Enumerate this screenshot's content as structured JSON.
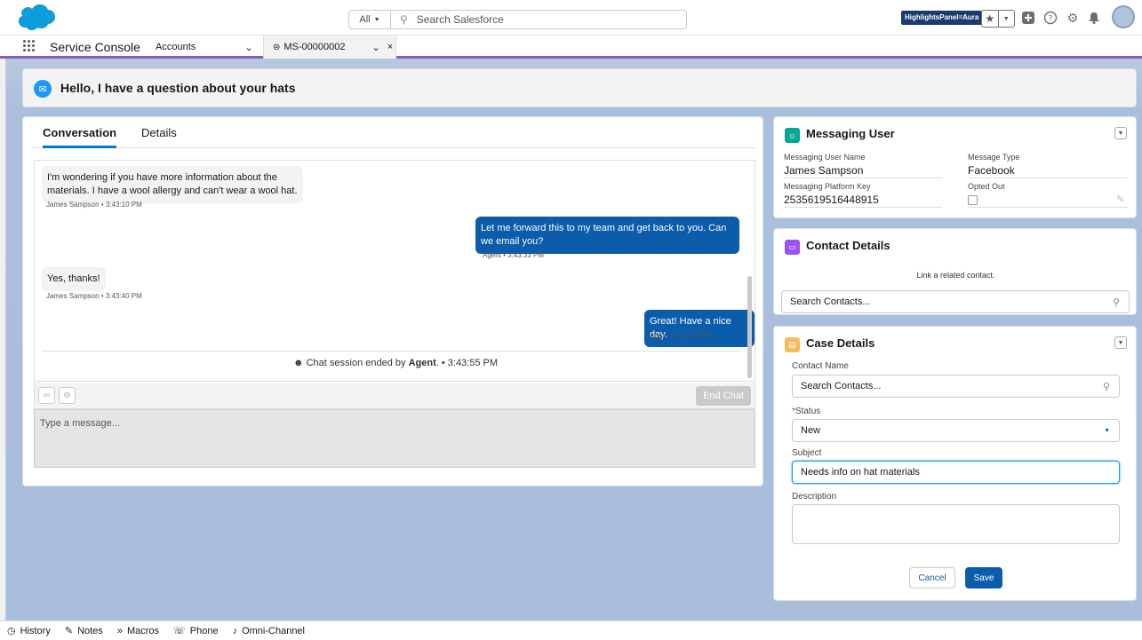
{
  "header": {
    "search_scope": "All",
    "search_placeholder": "Search Salesforce",
    "highlights_badge": "HighlightsPanel=Aura"
  },
  "nav": {
    "app_name": "Service Console",
    "tabs": [
      {
        "label": "Accounts"
      },
      {
        "label": "MS-00000002"
      }
    ]
  },
  "highlights": {
    "title": "Hello, I have a question about your hats"
  },
  "conversation": {
    "tabs": [
      "Conversation",
      "Details"
    ],
    "messages": [
      {
        "direction": "in",
        "text": "I'm wondering if you have more information about the materials. I have a wool allergy and can't wear a wool hat.",
        "meta": "James Sampson • 3:43:10 PM"
      },
      {
        "direction": "out",
        "text": "Let me forward this to my team and get back to you. Can we email you?",
        "meta": "Agent • 3:43:33 PM"
      },
      {
        "direction": "in",
        "text": "Yes, thanks!",
        "meta": "James Sampson • 3:43:40 PM"
      },
      {
        "direction": "out",
        "text": "Great! Have a nice day.",
        "meta": "Agent • 3:43:50 PM"
      }
    ],
    "ended_prefix": "Chat session ended by ",
    "ended_by": "Agent",
    "ended_suffix": ". • 3:43:55 PM",
    "end_chat_label": "End Chat",
    "compose_placeholder": "Type a message..."
  },
  "messaging_user": {
    "title": "Messaging User",
    "name_label": "Messaging User Name",
    "name_value": "James Sampson",
    "type_label": "Message Type",
    "type_value": "Facebook",
    "key_label": "Messaging Platform Key",
    "key_value": "2535619516448915",
    "opted_label": "Opted Out"
  },
  "contact_details": {
    "title": "Contact Details",
    "link_text": "Link a related contact.",
    "search_placeholder": "Search Contacts..."
  },
  "case_details": {
    "title": "Case Details",
    "contact_label": "Contact Name",
    "contact_placeholder": "Search Contacts...",
    "status_required": "*",
    "status_label": "Status",
    "status_value": "New",
    "subject_label": "Subject",
    "subject_value": "Needs info on hat materials",
    "description_label": "Description",
    "cancel_label": "Cancel",
    "save_label": "Save"
  },
  "utility_bar": [
    {
      "label": "History",
      "icon": "clock-icon"
    },
    {
      "label": "Notes",
      "icon": "notes-icon"
    },
    {
      "label": "Macros",
      "icon": "macros-icon"
    },
    {
      "label": "Phone",
      "icon": "phone-icon"
    },
    {
      "label": "Omni-Channel",
      "icon": "omni-channel-icon"
    }
  ],
  "colors": {
    "brand": "#0b5cab",
    "accent": "#1b96ff",
    "tab_underline": "#8b5db8"
  }
}
